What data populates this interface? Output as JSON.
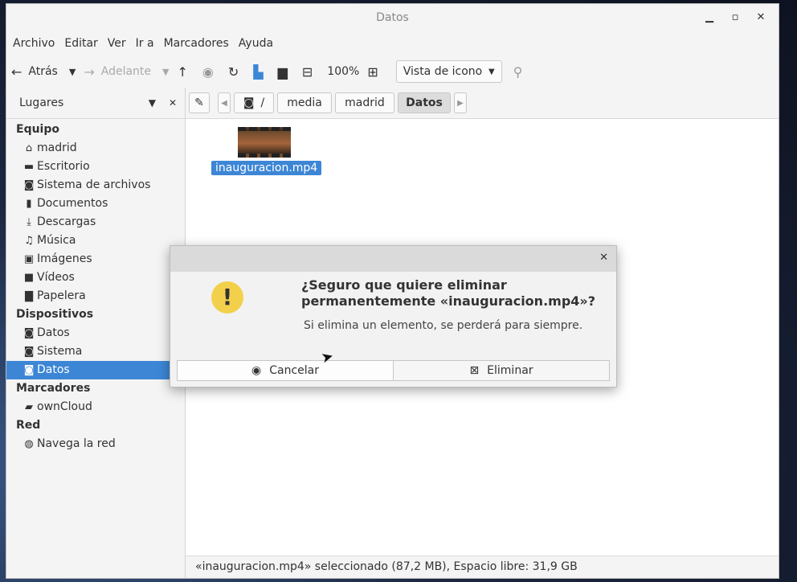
{
  "window": {
    "title": "Datos"
  },
  "menubar": [
    "Archivo",
    "Editar",
    "Ver",
    "Ir a",
    "Marcadores",
    "Ayuda"
  ],
  "toolbar": {
    "back": "Atrás",
    "forward": "Adelante",
    "zoom": "100%",
    "view": "Vista de icono"
  },
  "sidebar": {
    "header": "Lugares",
    "sections": [
      {
        "title": "Equipo",
        "items": [
          {
            "label": "madrid",
            "icon": "home-icon"
          },
          {
            "label": "Escritorio",
            "icon": "desktop-icon"
          },
          {
            "label": "Sistema de archivos",
            "icon": "drive-icon"
          },
          {
            "label": "Documentos",
            "icon": "document-icon"
          },
          {
            "label": "Descargas",
            "icon": "download-icon"
          },
          {
            "label": "Música",
            "icon": "music-icon"
          },
          {
            "label": "Imágenes",
            "icon": "image-icon"
          },
          {
            "label": "Vídeos",
            "icon": "video-icon"
          },
          {
            "label": "Papelera",
            "icon": "trash-icon"
          }
        ]
      },
      {
        "title": "Dispositivos",
        "items": [
          {
            "label": "Datos",
            "icon": "drive-icon"
          },
          {
            "label": "Sistema",
            "icon": "drive-icon"
          },
          {
            "label": "Datos",
            "icon": "drive-icon",
            "selected": true
          }
        ]
      },
      {
        "title": "Marcadores",
        "items": [
          {
            "label": "ownCloud",
            "icon": "folder-icon"
          }
        ]
      },
      {
        "title": "Red",
        "items": [
          {
            "label": "Navega la red",
            "icon": "globe-icon"
          }
        ]
      }
    ]
  },
  "pathbar": {
    "root": "/",
    "crumbs": [
      "media",
      "madrid",
      "Datos"
    ]
  },
  "file": {
    "name": "inauguracion.mp4"
  },
  "status": "«inauguracion.mp4» seleccionado (87,2 MB), Espacio libre: 31,9 GB",
  "dialog": {
    "heading_line1": "¿Seguro que quiere eliminar",
    "heading_line2": "permanentemente «inauguracion.mp4»?",
    "message": "Si elimina un elemento, se perderá para siempre.",
    "cancel": "Cancelar",
    "delete": "Eliminar"
  },
  "colors": {
    "accent": "#3d86d6",
    "warning": "#f3d04b"
  }
}
